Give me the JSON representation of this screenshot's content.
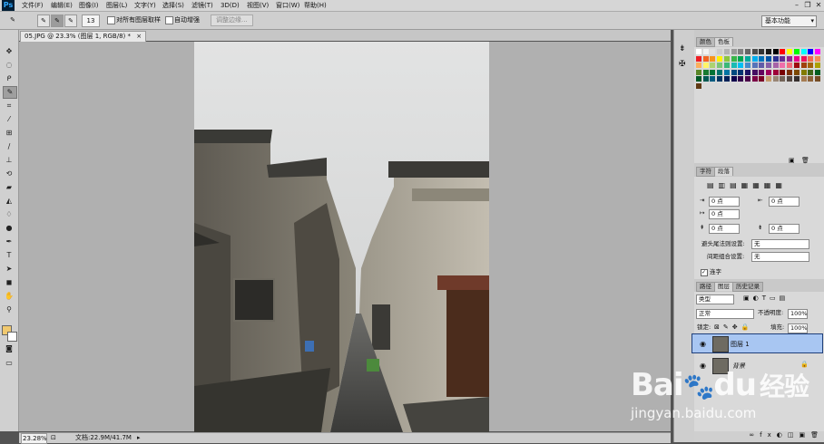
{
  "app": {
    "logo": "Ps"
  },
  "menu": [
    "文件(F)",
    "编辑(E)",
    "图像(I)",
    "图层(L)",
    "文字(Y)",
    "选择(S)",
    "滤镜(T)",
    "3D(D)",
    "视图(V)",
    "窗口(W)",
    "帮助(H)"
  ],
  "window_controls": {
    "minimize": "–",
    "restore": "❐",
    "close": "✕"
  },
  "options": {
    "brush_size": "13",
    "sample_all_layers": "对所有图层取样",
    "auto_enhance": "自动增强",
    "refine_edge": "调整边缘...",
    "workspace": "基本功能"
  },
  "document": {
    "tab_title": "05.JPG @ 23.3% (图层 1, RGB/8) *",
    "close": "×",
    "zoom": "23.28%",
    "doc_info": "文档:22.9M/41.7M"
  },
  "swatches_panel": {
    "tabs": [
      "颜色",
      "色板"
    ],
    "colors": [
      "#ffffff",
      "#f2f2f2",
      "#e0e0e0",
      "#cccccc",
      "#b3b3b3",
      "#999999",
      "#808080",
      "#666666",
      "#4d4d4d",
      "#333333",
      "#1a1a1a",
      "#000000",
      "#ff0000",
      "#ffff00",
      "#00ff00",
      "#00ffff",
      "#0000ff",
      "#ff00ff",
      "#ee1d24",
      "#f26522",
      "#f7941d",
      "#fff200",
      "#8dc63f",
      "#39b54a",
      "#00a651",
      "#00a99d",
      "#00aeef",
      "#0072bc",
      "#0054a6",
      "#2e3192",
      "#662d91",
      "#92278f",
      "#ec008c",
      "#ed145b",
      "#f26c4f",
      "#f68e56",
      "#fbaf5d",
      "#fff568",
      "#acd372",
      "#7cc576",
      "#3bb878",
      "#1abbb4",
      "#00bff3",
      "#448ccb",
      "#5674b9",
      "#605ca8",
      "#8560a8",
      "#a763a8",
      "#f06eaa",
      "#f26d7d",
      "#9e0b0f",
      "#a0410d",
      "#a3620a",
      "#aba000",
      "#598527",
      "#197b30",
      "#007236",
      "#00746b",
      "#0076a3",
      "#004a80",
      "#003471",
      "#1b1464",
      "#440e62",
      "#630460",
      "#9e005d",
      "#9e0039",
      "#790000",
      "#7b2e00",
      "#7d4900",
      "#827b00",
      "#406618",
      "#005e20",
      "#005826",
      "#005952",
      "#005b7f",
      "#003663",
      "#002157",
      "#0d004c",
      "#32004b",
      "#4b0049",
      "#7b0046",
      "#7a0026",
      "#c69c6d",
      "#998675",
      "#736357",
      "#534741",
      "#362f2d",
      "#a67c52",
      "#8c6239",
      "#754c24",
      "#603913"
    ]
  },
  "paragraph_panel": {
    "tabs": [
      "字符",
      "段落"
    ],
    "indent_left": "0 点",
    "indent_right": "0 点",
    "indent_first": "0 点",
    "space_before": "0 点",
    "space_after": "0 点",
    "kinsoku_label": "避头尾法则设置:",
    "kinsoku_value": "无",
    "mojikumi_label": "间距组合设置:",
    "mojikumi_value": "无",
    "hyphenate": "连字"
  },
  "layers_panel": {
    "tabs": [
      "路径",
      "图层",
      "历史记录"
    ],
    "filter_kind": "类型",
    "blend_mode": "正常",
    "opacity_label": "不透明度:",
    "opacity_value": "100%",
    "lock_label": "锁定:",
    "fill_label": "填充:",
    "fill_value": "100%",
    "layers": [
      {
        "name": "图层 1",
        "selected": true
      },
      {
        "name": "背景",
        "selected": false
      }
    ]
  },
  "watermark": {
    "brand": "Bai",
    "paw": "du",
    "cn": "经验",
    "url": "jingyan.baidu.com"
  }
}
